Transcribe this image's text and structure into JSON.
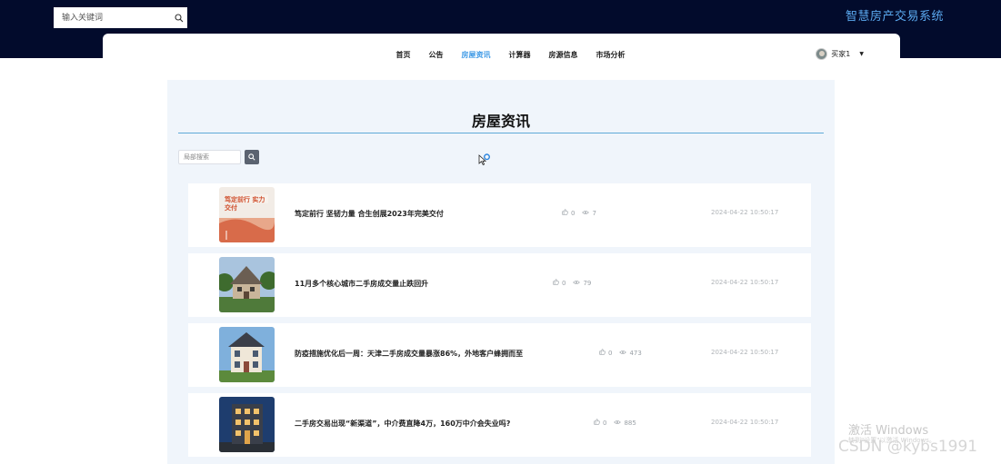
{
  "header": {
    "search_placeholder": "输入关键词",
    "site_title": "智慧房产交易系统"
  },
  "nav": {
    "items": [
      "首页",
      "公告",
      "房屋资讯",
      "计算器",
      "房源信息",
      "市场分析"
    ],
    "active_index": 2
  },
  "user": {
    "name": "买家1"
  },
  "page": {
    "title": "房屋资讯",
    "local_search_placeholder": "局部搜索"
  },
  "news": [
    {
      "title": "笃定前行 坚韧力量 合生创展2023年完美交付",
      "likes": "0",
      "views": "7",
      "time": "2024-04-22 10:50:17"
    },
    {
      "title": "11月多个核心城市二手房成交量止跌回升",
      "likes": "0",
      "views": "79",
      "time": "2024-04-22 10:50:17"
    },
    {
      "title": "防疫措施优化后一周：天津二手房成交量暴涨86%，外地客户蜂拥而至",
      "likes": "0",
      "views": "473",
      "time": "2024-04-22 10:50:17"
    },
    {
      "title": "二手房交易出现“新渠道”，中介费直降4万，160万中介会失业吗?",
      "likes": "0",
      "views": "885",
      "time": "2024-04-22 10:50:17"
    }
  ],
  "thumb1_text": "笃定前行 实力交付",
  "watermark": {
    "activate": "激活 Windows",
    "activate_sub": "转到\"设置\"以激活 Windows。",
    "csdn": "CSDN @kybs1991"
  },
  "colors": {
    "topbar": "#020b2c",
    "accent": "#3f9ae6",
    "content_bg": "#f0f5fb"
  }
}
